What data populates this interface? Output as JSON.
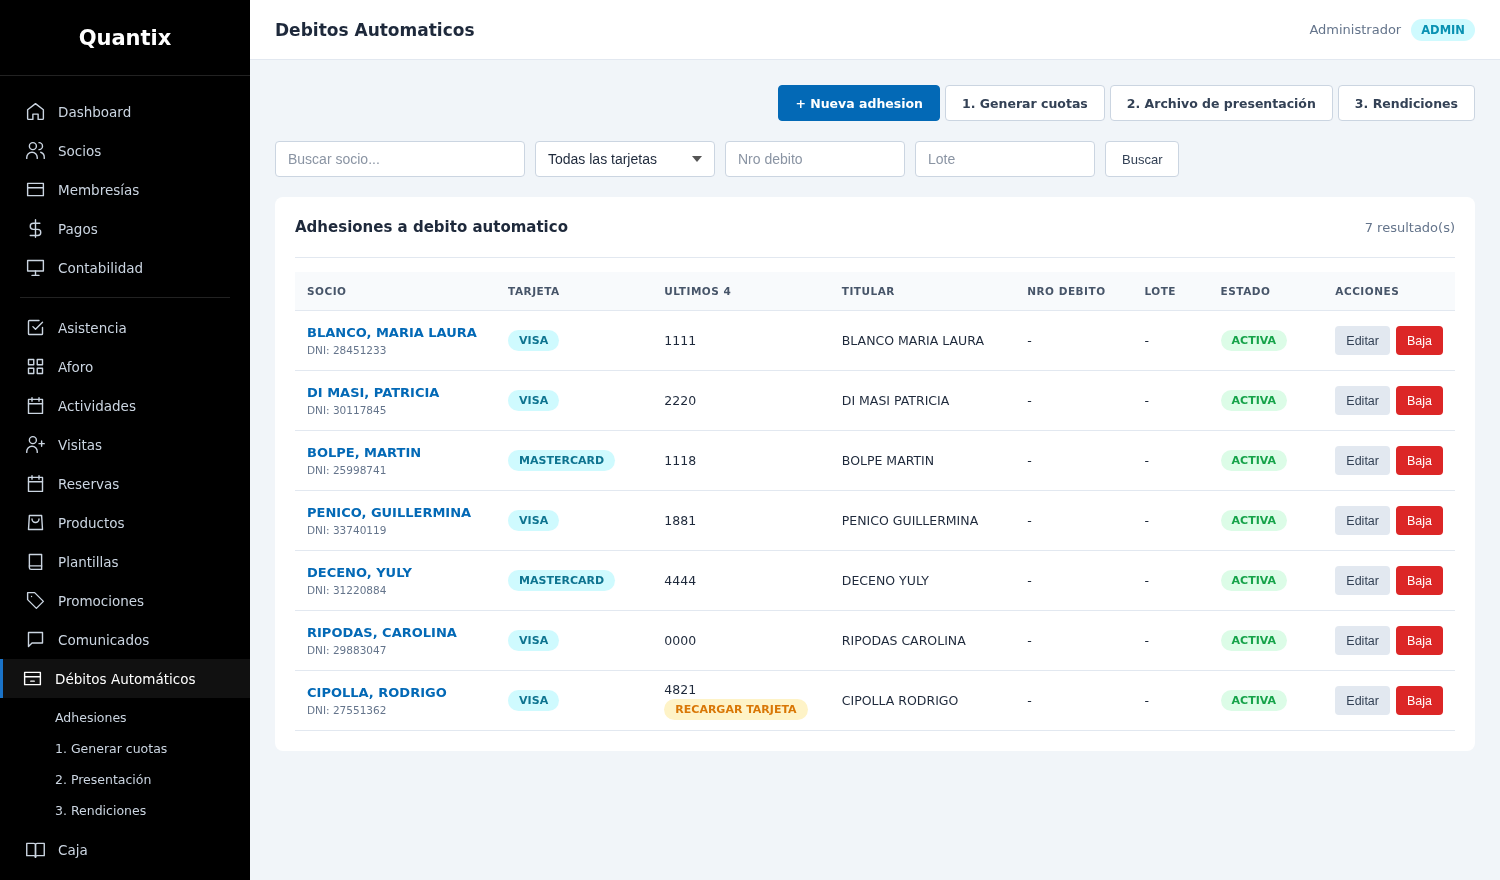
{
  "brand": "Quantix",
  "sidebar": {
    "groups": [
      {
        "items": [
          {
            "label": "Dashboard",
            "selected": false
          },
          {
            "label": "Socios",
            "selected": false
          },
          {
            "label": "Membresías",
            "selected": false
          },
          {
            "label": "Pagos",
            "selected": false
          },
          {
            "label": "Contabilidad",
            "selected": false
          }
        ]
      },
      {
        "items": [
          {
            "label": "Asistencia",
            "selected": false
          },
          {
            "label": "Aforo",
            "selected": false
          },
          {
            "label": "Actividades",
            "selected": false
          },
          {
            "label": "Visitas",
            "selected": false
          },
          {
            "label": "Reservas",
            "selected": false
          },
          {
            "label": "Productos",
            "selected": false
          },
          {
            "label": "Plantillas",
            "selected": false
          },
          {
            "label": "Promociones",
            "selected": false
          },
          {
            "label": "Comunicados",
            "selected": false
          },
          {
            "label": "Débitos Automáticos",
            "selected": true,
            "children": [
              {
                "label": "Adhesiones",
                "selected": false
              },
              {
                "label": "1. Generar cuotas",
                "selected": false
              },
              {
                "label": "2. Presentación",
                "selected": false
              },
              {
                "label": "3. Rendiciones",
                "selected": false
              }
            ]
          },
          {
            "label": "Caja",
            "selected": false
          }
        ]
      }
    ]
  },
  "header": {
    "title": "Debitos Automaticos",
    "user": "Administrador",
    "role": "ADMIN"
  },
  "actions": [
    {
      "label": "+ Nueva adhesion",
      "kind": "primary"
    },
    {
      "label": "1. Generar cuotas",
      "kind": "secondary"
    },
    {
      "label": "2. Archivo de presentación",
      "kind": "secondary"
    },
    {
      "label": "3. Rendiciones",
      "kind": "secondary"
    }
  ],
  "filters": {
    "search": {
      "placeholder": "Buscar socio..."
    },
    "card_select": {
      "value": "Todas las tarjetas"
    },
    "nro_debito": {
      "placeholder": "Nro debito"
    },
    "lote": {
      "placeholder": "Lote"
    },
    "button": "Buscar"
  },
  "table": {
    "title": "Adhesiones a debito automatico",
    "count": "7 resultado(s)",
    "columns": [
      "SOCIO",
      "TARJETA",
      "ULTIMOS 4",
      "TITULAR",
      "NRO DEBITO",
      "LOTE",
      "ESTADO",
      "ACCIONES"
    ],
    "rows": [
      {
        "socio": "BLANCO, MARIA LAURA",
        "dni": "DNI: 28451233",
        "tarjeta": "VISA",
        "ultimos4": "1111",
        "titular": "BLANCO MARIA LAURA",
        "nro": "-",
        "lote": "-",
        "estado": "ACTIVA",
        "edit": "Editar",
        "delete": "Baja"
      },
      {
        "socio": "DI MASI, PATRICIA",
        "dni": "DNI: 30117845",
        "tarjeta": "VISA",
        "ultimos4": "2220",
        "titular": "DI MASI PATRICIA",
        "nro": "-",
        "lote": "-",
        "estado": "ACTIVA",
        "edit": "Editar",
        "delete": "Baja"
      },
      {
        "socio": "BOLPE, MARTIN",
        "dni": "DNI: 25998741",
        "tarjeta": "MASTERCARD",
        "ultimos4": "1118",
        "titular": "BOLPE MARTIN",
        "nro": "-",
        "lote": "-",
        "estado": "ACTIVA",
        "edit": "Editar",
        "delete": "Baja"
      },
      {
        "socio": "PENICO, GUILLERMINA",
        "dni": "DNI: 33740119",
        "tarjeta": "VISA",
        "ultimos4": "1881",
        "titular": "PENICO GUILLERMINA",
        "nro": "-",
        "lote": "-",
        "estado": "ACTIVA",
        "edit": "Editar",
        "delete": "Baja"
      },
      {
        "socio": "DECENO, YULY",
        "dni": "DNI: 31220884",
        "tarjeta": "MASTERCARD",
        "ultimos4": "4444",
        "titular": "DECENO YULY",
        "nro": "-",
        "lote": "-",
        "estado": "ACTIVA",
        "edit": "Editar",
        "delete": "Baja"
      },
      {
        "socio": "RIPODAS, CAROLINA",
        "dni": "DNI: 29883047",
        "tarjeta": "VISA",
        "ultimos4": "0000",
        "titular": "RIPODAS CAROLINA",
        "nro": "-",
        "lote": "-",
        "estado": "ACTIVA",
        "edit": "Editar",
        "delete": "Baja"
      },
      {
        "socio": "CIPOLLA, RODRIGO",
        "dni": "DNI: 27551362",
        "tarjeta": "VISA",
        "ultimos4": "4821",
        "alert": "RECARGAR TARJETA",
        "titular": "CIPOLLA RODRIGO",
        "nro": "-",
        "lote": "-",
        "estado": "ACTIVA",
        "edit": "Editar",
        "delete": "Baja"
      }
    ]
  }
}
